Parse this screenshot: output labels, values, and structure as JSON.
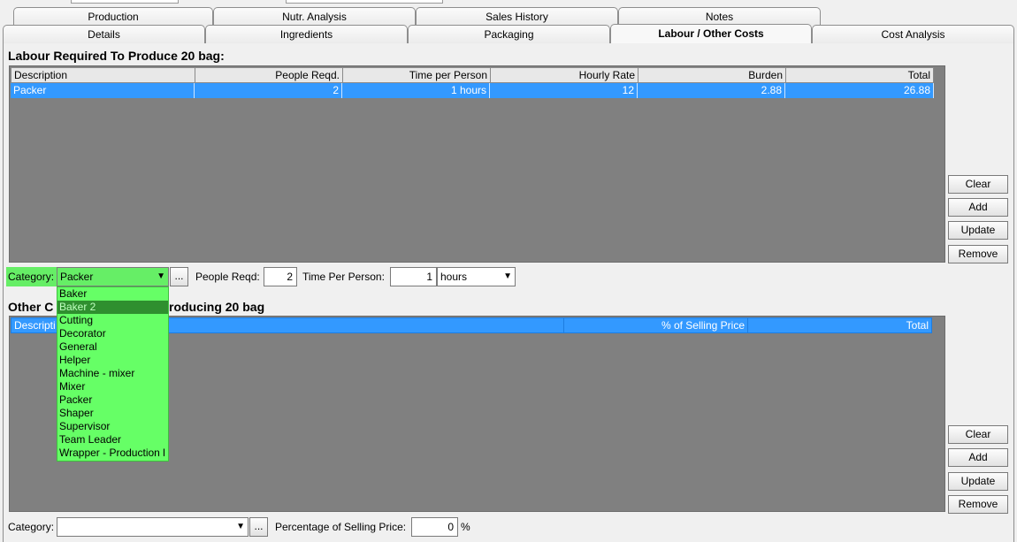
{
  "tabs_row1": [
    "Production",
    "Nutr. Analysis",
    "Sales History",
    "Notes"
  ],
  "tabs_row2": [
    "Details",
    "Ingredients",
    "Packaging",
    "Labour / Other Costs",
    "Cost Analysis"
  ],
  "labour": {
    "title": "Labour Required To Produce 20 bag:",
    "columns": [
      "Description",
      "People Reqd.",
      "Time per Person",
      "Hourly Rate",
      "Burden",
      "Total"
    ],
    "rows": [
      [
        "Packer",
        "2",
        "1 hours",
        "12",
        "2.88",
        "26.88"
      ]
    ],
    "buttons": {
      "clear": "Clear",
      "add": "Add",
      "update": "Update",
      "remove": "Remove"
    },
    "category_label": "Category:",
    "category_value": "Packer",
    "dots": "...",
    "people_label": "People Reqd:",
    "people_value": "2",
    "time_label": "Time Per Person:",
    "time_value": "1",
    "time_unit": "hours"
  },
  "dropdown": {
    "options": [
      "Baker",
      "Baker 2",
      "Cutting",
      "Decorator",
      "General",
      "Helper",
      "Machine - mixer",
      "Mixer",
      "Packer",
      "Shaper",
      "Supervisor",
      "Team Leader",
      "Wrapper - Production l"
    ],
    "highlighted_index": 1,
    "colors": {
      "background": "#66ff66",
      "highlight": "#2f8f2f"
    }
  },
  "other": {
    "title_left": "Other C",
    "title_right": "roducing 20 bag",
    "columns": [
      "Descripti",
      "% of Selling Price",
      "Total"
    ],
    "buttons": {
      "clear": "Clear",
      "add": "Add",
      "update": "Update",
      "remove": "Remove"
    },
    "category_label": "Category:",
    "category_value": "",
    "dots": "...",
    "percentage_label": "Percentage of Selling Price:",
    "percentage_value": "0",
    "percent_sign": "%"
  },
  "colors": {
    "selection": "#3399ff",
    "grid_background": "#808080",
    "category_green": "#66ee66"
  }
}
